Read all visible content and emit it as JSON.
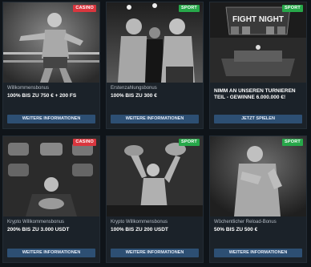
{
  "cards": [
    {
      "badge": "CASINO",
      "badge_type": "casino",
      "subtitle": "Willkommensbonus",
      "title": "100% bis zu 750 € + 200 FS",
      "button": "WEITERE INFORMATIONEN"
    },
    {
      "badge": "SPORT",
      "badge_type": "sport",
      "subtitle": "Erstenzahlungsbonus",
      "title": "100% bis zu 300 €",
      "button": "WEITERE INFORMATIONEN"
    },
    {
      "badge": "SPORT",
      "badge_type": "sport",
      "subtitle": "",
      "title": "NIMM AN UNSEREN TURNIEREN TEIL - GEWINNE 6.000.000 €!",
      "button": "JETZT SPIELEN",
      "image_text": "FIGHT NIGHT"
    },
    {
      "badge": "CASINO",
      "badge_type": "casino",
      "subtitle": "Krypto Willkommensbonus",
      "title": "200% bis zu 3.000 USDT",
      "button": "WEITERE INFORMATIONEN"
    },
    {
      "badge": "SPORT",
      "badge_type": "sport",
      "subtitle": "Krypto Willkommensbonus",
      "title": "100% bis zu 200 USDT",
      "button": "WEITERE INFORMATIONEN"
    },
    {
      "badge": "SPORT",
      "badge_type": "sport",
      "subtitle": "Wöchentlicher Reload-Bonus",
      "title": "50% bis zu 500 €",
      "button": "WEITERE INFORMATIONEN"
    }
  ],
  "colors": {
    "casino": "#d9363e",
    "sport": "#27a84a",
    "button": "#2d4f73",
    "card": "#1b2229"
  }
}
